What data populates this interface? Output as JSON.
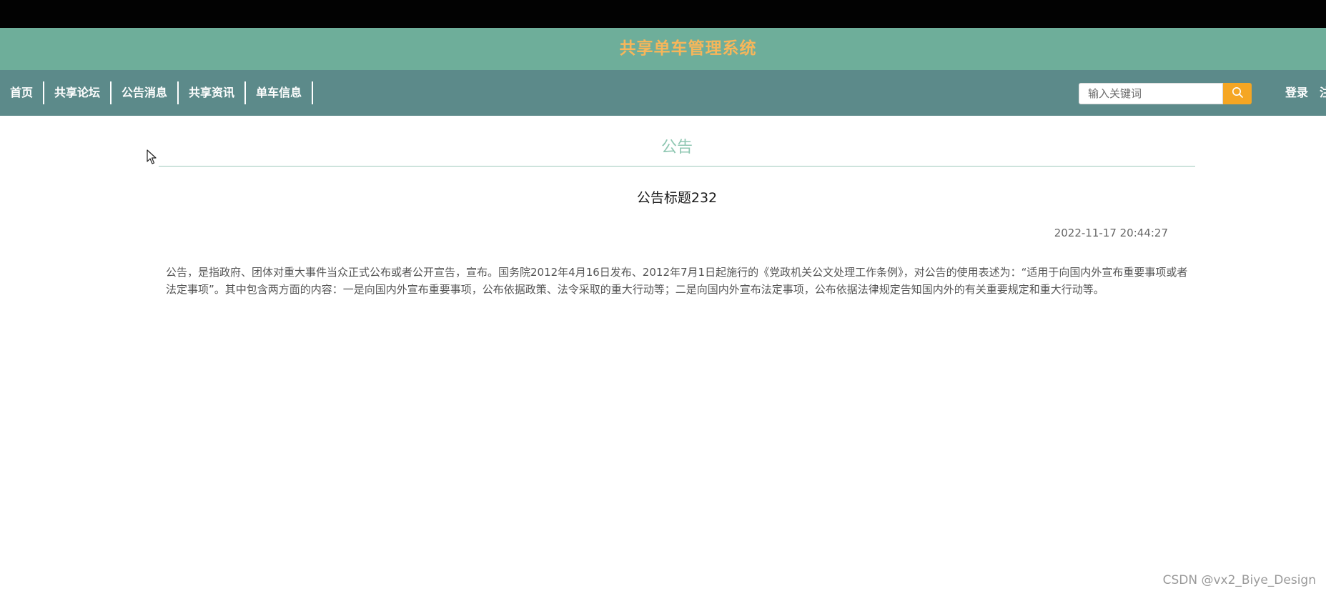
{
  "header": {
    "site_title": "共享单车管理系统"
  },
  "nav": {
    "items": [
      {
        "label": "首页"
      },
      {
        "label": "共享论坛"
      },
      {
        "label": "公告消息"
      },
      {
        "label": "共享资讯"
      },
      {
        "label": "单车信息"
      }
    ],
    "search": {
      "placeholder": "输入关键词",
      "icon": "search-icon"
    },
    "login_label": "登录",
    "register_label": "注"
  },
  "main": {
    "section_heading": "公告",
    "article": {
      "title": "公告标题232",
      "date": "2022-11-17 20:44:27",
      "body": "公告，是指政府、团体对重大事件当众正式公布或者公开宣告，宣布。国务院2012年4月16日发布、2012年7月1日起施行的《党政机关公文处理工作条例》，对公告的使用表述为：“适用于向国内外宣布重要事项或者法定事项”。其中包含两方面的内容：一是向国内外宣布重要事项，公布依据政策、法令采取的重大行动等；二是向国内外宣布法定事项，公布依据法律规定告知国内外的有关重要规定和重大行动等。"
    }
  },
  "watermark": "CSDN @vx2_Biye_Design",
  "colors": {
    "title_bar": "#6eae9a",
    "nav_bar": "#5c8a8a",
    "title_text": "#f7b65a",
    "search_button": "#f5a623",
    "heading": "#8fc7b2"
  }
}
